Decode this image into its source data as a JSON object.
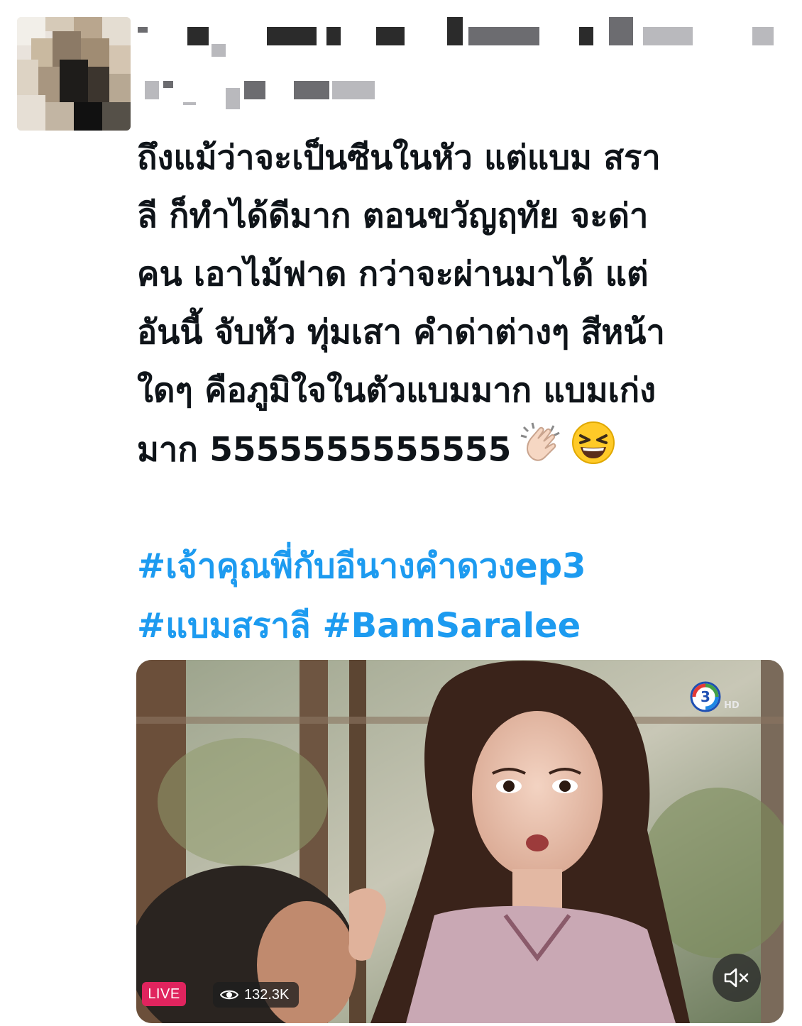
{
  "tweet": {
    "text_lines": [
      "ถึงแม้ว่าจะเป็นซีนในหัว แต่แบม สรา",
      "ลี ก็ทำได้ดีมาก ตอนขวัญฤทัย จะด่า",
      "คน เอาไม้ฟาด กว่าจะผ่านมาได้ แต่",
      "อันนี้ จับหัว ทุ่มเสา คำด่าต่างๆ  สีหน้า",
      "ใดๆ คือภูมิใจในตัวแบมมาก แบมเก่ง",
      "มาก 5555555555555"
    ],
    "emojis": [
      "clapping-hands",
      "grinning-squinting-face"
    ],
    "hashtags": [
      "#เจ้าคุณพี่กับอีนางคำดวงep3",
      "#แบมสราลี",
      "#BamSaralee"
    ]
  },
  "media": {
    "live_label": "LIVE",
    "view_count": "132.3K",
    "channel_logo_text": "3",
    "channel_logo_suffix": "HD",
    "icons": [
      "eye-icon",
      "mute-icon"
    ]
  },
  "colors": {
    "text": "#0f1419",
    "hashtag": "#1d9bf0",
    "live": "#e0245e"
  }
}
